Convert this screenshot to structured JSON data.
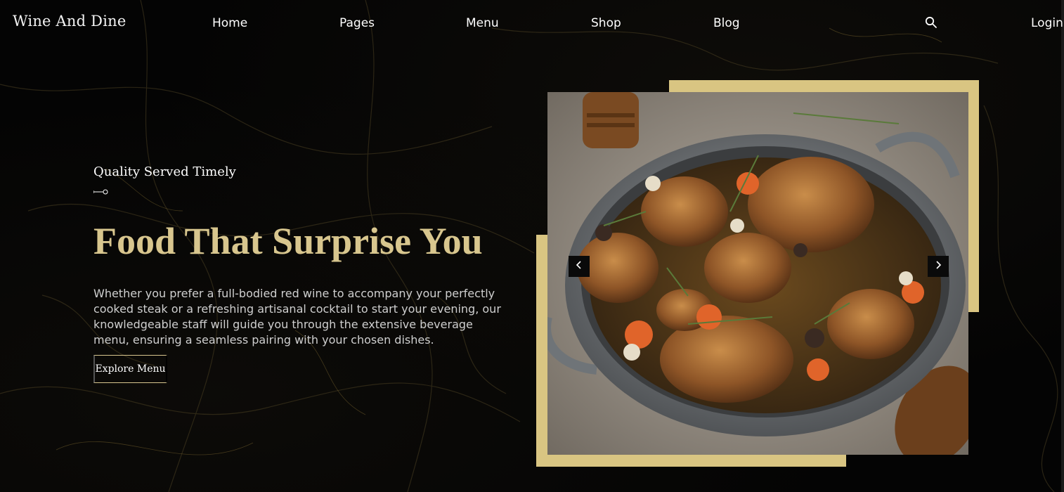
{
  "nav": {
    "logo": "Wine And Dine",
    "links": [
      "Home",
      "Pages",
      "Menu",
      "Shop",
      "Blog"
    ],
    "search_icon": "search-icon",
    "login": "Login"
  },
  "hero": {
    "eyebrow": "Quality Served Timely",
    "headline": "Food That Surprise You",
    "description": "Whether you prefer a full-bodied red wine to accompany your perfectly cooked steak or a refreshing artisanal cocktail to start your evening, our knowledgeable staff will guide you through the extensive beverage menu, ensuring a seamless pairing with your chosen dishes.",
    "cta": "Explore Menu"
  },
  "slider": {
    "prev_icon": "chevron-left-icon",
    "next_icon": "chevron-right-icon"
  },
  "colors": {
    "background": "#030303",
    "accent_gold": "#d8c68e",
    "frame_gold": "#d9c582"
  }
}
